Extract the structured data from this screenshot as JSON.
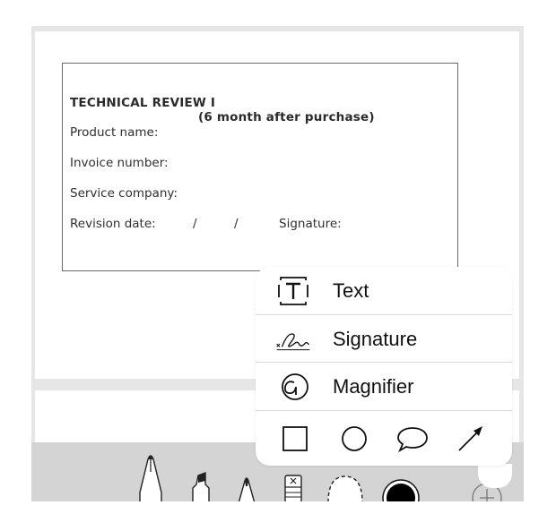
{
  "document": {
    "title": "TECHNICAL REVIEW I",
    "subtitle": "(6 month after purchase)",
    "fields": {
      "product_name": "Product name:",
      "invoice_number": "Invoice number:",
      "service_company": "Service company:",
      "revision_date": "Revision date:",
      "date_separator": "/",
      "signature": "Signature:"
    }
  },
  "markup_menu": {
    "items": [
      {
        "label": "Text",
        "icon": "text-box-icon"
      },
      {
        "label": "Signature",
        "icon": "signature-icon"
      },
      {
        "label": "Magnifier",
        "icon": "magnifier-icon"
      }
    ],
    "shapes": [
      "square-icon",
      "circle-icon",
      "speech-bubble-icon",
      "arrow-icon"
    ]
  },
  "toolbar": {
    "tools": [
      "pen-icon",
      "highlighter-icon",
      "pencil-icon",
      "eraser-icon",
      "lasso-icon",
      "color-picker-icon",
      "add-icon"
    ],
    "selected_color": "#000000"
  }
}
